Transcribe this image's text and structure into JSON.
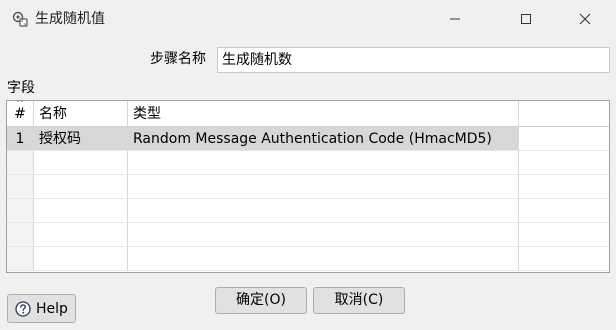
{
  "window": {
    "title": "生成随机值",
    "icons": {
      "app": "gear-dice-icon",
      "minimize": "minimize-icon",
      "maximize": "maximize-icon",
      "close": "close-icon"
    }
  },
  "form": {
    "step_name_label": "步骤名称",
    "step_name_value": "生成随机数"
  },
  "fields": {
    "section_label": "字段",
    "columns": [
      "#",
      "名称",
      "类型"
    ],
    "rows": [
      {
        "num": "1",
        "name": "授权码",
        "type": "Random Message Authentication Code (HmacMD5)"
      }
    ]
  },
  "buttons": {
    "ok": "确定(O)",
    "cancel": "取消(C)",
    "help": "Help",
    "help_icon": "question-circle-icon"
  },
  "colors": {
    "selected_row": "#d7d7d7",
    "window_bg": "#f0f0f0"
  }
}
